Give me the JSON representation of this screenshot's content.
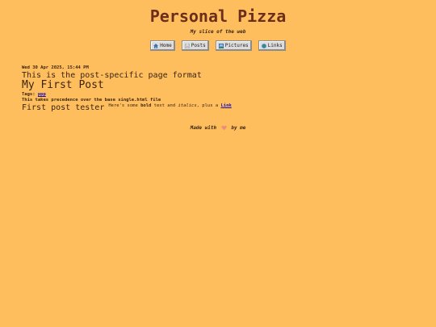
{
  "site": {
    "title": "Personal Pizza",
    "tagline": "My slice of the web"
  },
  "nav": {
    "items": [
      {
        "label": "Home",
        "icon": "home-icon"
      },
      {
        "label": "Posts",
        "icon": "document-icon"
      },
      {
        "label": "Pictures",
        "icon": "picture-icon"
      },
      {
        "label": "Links",
        "icon": "globe-icon"
      }
    ]
  },
  "post": {
    "date": "Wed 30 Apr 2025, 15:44 PM",
    "format_note": "This is the post-specific page format",
    "title": "My First Post",
    "tags_label": "Tags:",
    "tag": "ppp",
    "override_note": "This takes precedence over the base single.html file",
    "content": {
      "heading": "First post tester",
      "text_before_bold": "Here's some ",
      "bold_text": "bold",
      "text_middle": " text and ",
      "italic_text": "italics",
      "text_after": ", plus a ",
      "link_text": "Link"
    }
  },
  "footer": {
    "made_with": "Made with",
    "by_me": "by me",
    "heart_icon": "heart-icon"
  }
}
